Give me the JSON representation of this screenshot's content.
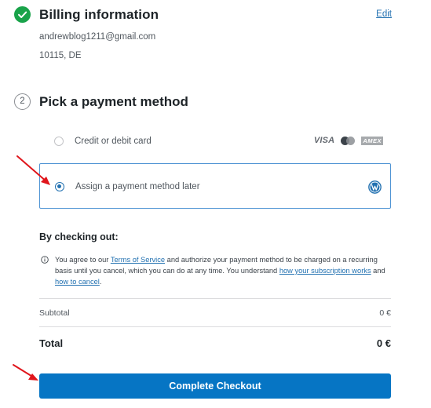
{
  "billing": {
    "title": "Billing information",
    "edit_label": "Edit",
    "email": "andrewblog1211@gmail.com",
    "address": "10115, DE",
    "status_icon": "check-circle-icon",
    "status_color": "#19a34a"
  },
  "payment": {
    "step_number": "2",
    "title": "Pick a payment method",
    "options": [
      {
        "label": "Credit or debit card",
        "selected": false,
        "logos": [
          "VISA",
          "mastercard-icon",
          "AMEX"
        ]
      },
      {
        "label": "Assign a payment method later",
        "selected": true,
        "icon": "wordpress-icon"
      }
    ]
  },
  "checkout": {
    "heading": "By checking out:",
    "terms": {
      "part1": "You agree to our ",
      "link1": "Terms of Service",
      "part2": " and authorize your payment method to be charged on a recurring basis until you cancel, which you can do at any time. You understand ",
      "link2": "how your subscription works",
      "part3": " and ",
      "link3": "how to cancel",
      "part4": "."
    }
  },
  "summary": {
    "subtotal_label": "Subtotal",
    "subtotal_value": "0 €",
    "total_label": "Total",
    "total_value": "0 €"
  },
  "actions": {
    "complete_label": "Complete Checkout",
    "accent_color": "#0675c4"
  },
  "annotations": {
    "arrow_color": "#e0151b"
  }
}
